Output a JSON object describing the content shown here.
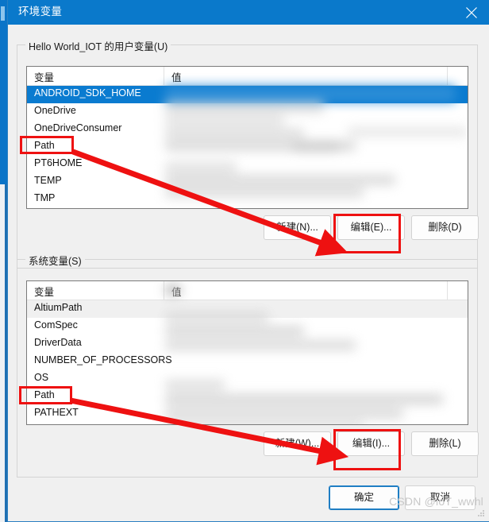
{
  "window": {
    "title": "环境变量",
    "close_icon": "close-icon",
    "ok_label": "确定",
    "cancel_label": "取消"
  },
  "user_variables": {
    "group_label": "Hello World_IOT 的用户变量(U)",
    "columns": [
      "变量",
      "值"
    ],
    "rows": [
      {
        "name": "ANDROID_SDK_HOME",
        "value": "",
        "state": "selected"
      },
      {
        "name": "OneDrive",
        "value": "",
        "state": "normal"
      },
      {
        "name": "OneDriveConsumer",
        "value": "",
        "state": "normal"
      },
      {
        "name": "Path",
        "value": "",
        "state": "normal"
      },
      {
        "name": "PT6HOME",
        "value": "",
        "state": "normal"
      },
      {
        "name": "TEMP",
        "value": "",
        "state": "normal"
      },
      {
        "name": "TMP",
        "value": "",
        "state": "normal"
      }
    ],
    "buttons": {
      "new_label": "新建(N)...",
      "edit_label": "编辑(E)...",
      "delete_label": "删除(D)"
    }
  },
  "system_variables": {
    "group_label": "系统变量(S)",
    "columns": [
      "变量",
      "值"
    ],
    "rows": [
      {
        "name": "AltiumPath",
        "value": "",
        "state": "hot"
      },
      {
        "name": "ComSpec",
        "value": "",
        "state": "normal"
      },
      {
        "name": "DriverData",
        "value": "",
        "state": "normal"
      },
      {
        "name": "NUMBER_OF_PROCESSORS",
        "value": "",
        "state": "normal"
      },
      {
        "name": "OS",
        "value": "",
        "state": "normal"
      },
      {
        "name": "Path",
        "value": "",
        "state": "normal"
      },
      {
        "name": "PATHEXT",
        "value": "",
        "state": "normal"
      }
    ],
    "buttons": {
      "new_label": "新建(W)...",
      "edit_label": "编辑(I)...",
      "delete_label": "删除(L)"
    }
  },
  "annotations": {
    "color": "#ee1111",
    "highlight_boxes": [
      "user-path-row",
      "user-edit-button",
      "system-path-row",
      "system-edit-button"
    ],
    "arrows": [
      {
        "from": "user-path-row",
        "to": "user-edit-button"
      },
      {
        "from": "system-path-row",
        "to": "system-edit-button"
      }
    ]
  },
  "watermark": {
    "text": "CSDN @ioT_wwhl"
  },
  "colors": {
    "title_bar": "#0a79cb",
    "selection": "#0a7bd0",
    "accent": "#1f7ec4",
    "annotation": "#ee1111",
    "dialog_bg": "#f0f0f0"
  }
}
